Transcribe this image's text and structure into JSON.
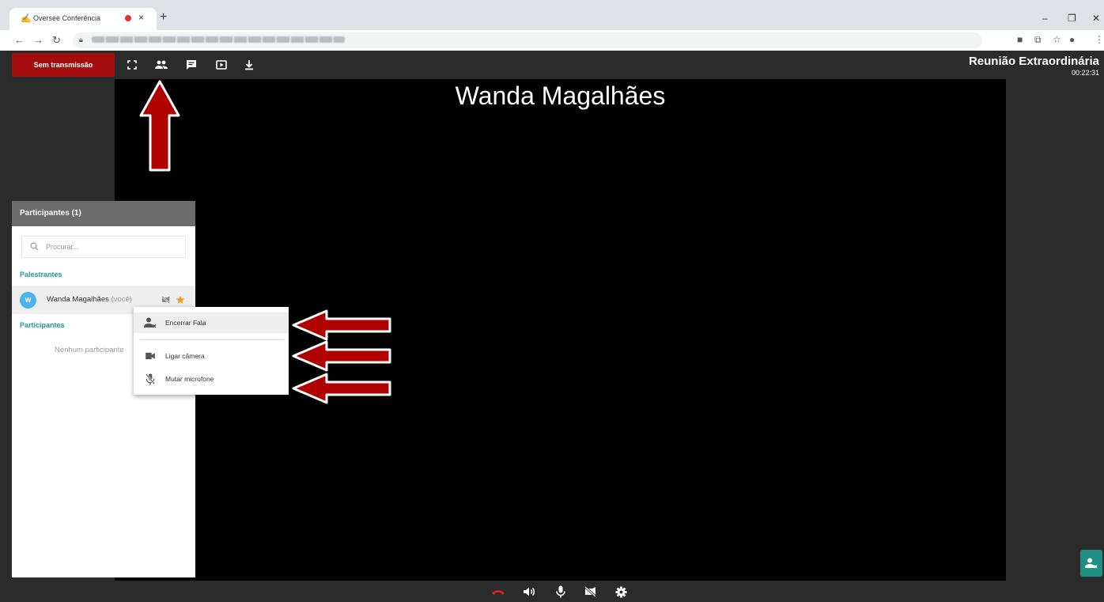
{
  "browser": {
    "tab_title": "Oversee Conferência",
    "tab_close": "×",
    "new_tab": "+"
  },
  "app": {
    "transmission_label": "Sem transmissão",
    "meeting_title": "Reunião Extraordinária",
    "timer": "00:22:31",
    "toolbar_icons": [
      "fullscreen-icon",
      "participants-icon",
      "chat-icon",
      "present-icon",
      "download-icon"
    ],
    "bottom_icons": [
      "hangup-icon",
      "speaker-icon",
      "mic-icon",
      "camera-off-icon",
      "settings-icon"
    ]
  },
  "stage": {
    "speaker_name": "Wanda Magalhães"
  },
  "participants_panel": {
    "title": "Participantes (1)",
    "search_placeholder": "Procurar...",
    "speakers_section": "Palestrantes",
    "participants_section": "Participantes",
    "speaker": {
      "initial": "W",
      "name": "Wanda Magalhães",
      "you_tag": "(você)"
    },
    "empty_text": "Nenhum participante"
  },
  "context_menu": {
    "items": [
      {
        "label": "Encerrar Fala",
        "icon": "end-speech-icon"
      },
      {
        "label": "Ligar câmera",
        "icon": "camera-icon"
      },
      {
        "label": "Mutar microfone",
        "icon": "mic-off-icon"
      }
    ]
  },
  "colors": {
    "transmission_bg": "#a30d0d",
    "accent_teal": "#1a9aa0",
    "avatar": "#4ab3f0",
    "star": "#f39a1d",
    "annotation_arrow": "#b00000"
  }
}
